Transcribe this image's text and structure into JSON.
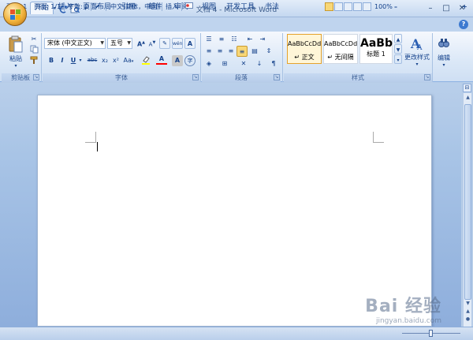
{
  "window": {
    "title": "文档 4 - Microsoft Word",
    "min": "–",
    "max": "□",
    "close": "✕"
  },
  "qat": {
    "save_icon": "save-icon",
    "undo_icon": "undo-icon",
    "redo_icon": "redo-icon",
    "print_preview_icon": "print-preview-icon",
    "customize_icon": "dropdown-icon"
  },
  "tabs": [
    "开始",
    "插入",
    "页面布局",
    "引用",
    "邮件",
    "审阅",
    "视图",
    "开发工具",
    "书法"
  ],
  "active_tab": "开始",
  "clipboard": {
    "paste_label": "粘贴",
    "group_label": "剪贴板"
  },
  "font": {
    "font_name": "宋体 (中文正文)",
    "font_size": "五号",
    "grow": "A",
    "shrink": "A",
    "phonetic": "wén",
    "bold": "B",
    "italic": "I",
    "underline": "U",
    "strike": "abc",
    "subscript": "x₂",
    "superscript": "x²",
    "change_case": "Aa",
    "font_color": "A",
    "char_shade": "A",
    "enclose": "字",
    "group_label": "字体"
  },
  "paragraph": {
    "group_label": "段落"
  },
  "styles": {
    "items": [
      {
        "preview": "AaBbCcDd",
        "name": "↵ 正文"
      },
      {
        "preview": "AaBbCcDd",
        "name": "↵ 无间隔"
      },
      {
        "preview": "AaBb",
        "name": "标题 1"
      }
    ],
    "change_styles": "更改样式",
    "group_label": "样式"
  },
  "editing": {
    "label": "编辑"
  },
  "statusbar": {
    "page": "页面: 1",
    "pages": "页面: 1/1",
    "words": "字数: 0",
    "language": "中文(简体，中国)",
    "mode": "插入",
    "zoom": "100%",
    "zoom_minus": "–",
    "zoom_plus": "+"
  },
  "watermark": {
    "text": "Bai 经验",
    "sub": "jingyan.baidu.com"
  },
  "colors": {
    "accent": "#15428b",
    "highlight": "#ffff00",
    "font_color": "#ff0000"
  }
}
